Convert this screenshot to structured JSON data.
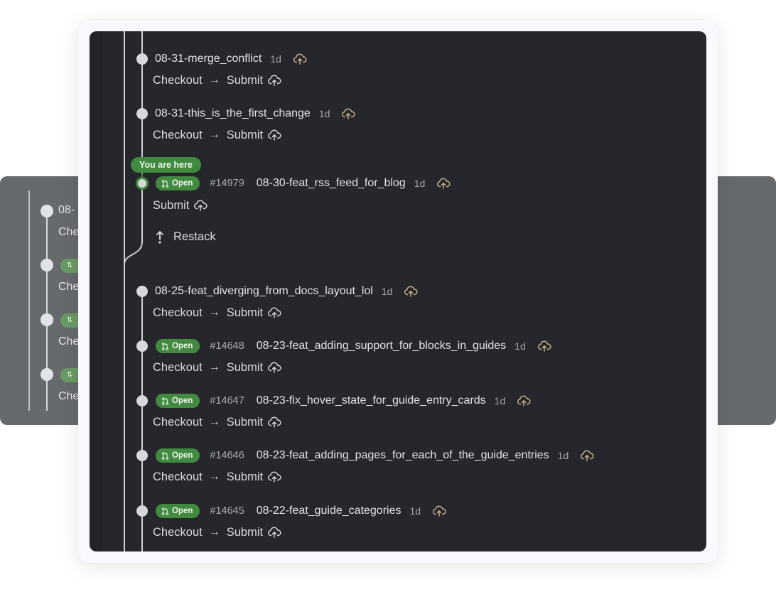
{
  "colors": {
    "panel_bg": "#25272c",
    "badge_green": "#418a3f",
    "cloud_tan": "#c8b185",
    "node": "#d6d8db"
  },
  "current_label": "You are here",
  "badge_icon": "git-pull-request-icon",
  "action_labels": {
    "checkout": "Checkout",
    "arrow": "→",
    "submit": "Submit",
    "restack": "Restack"
  },
  "branches": [
    {
      "name": "08-31-merge_conflict",
      "age": "1d",
      "status": null,
      "pr": null,
      "actions": [
        "Checkout",
        "Submit"
      ]
    },
    {
      "name": "08-31-this_is_the_first_change",
      "age": "1d",
      "status": null,
      "pr": null,
      "actions": [
        "Checkout",
        "Submit"
      ]
    },
    {
      "name": "08-30-feat_rss_feed_for_blog",
      "age": "1d",
      "status": "Open",
      "pr": "#14979",
      "current": true,
      "actions": [
        "Submit"
      ],
      "extra_action": "Restack"
    },
    {
      "name": "08-25-feat_diverging_from_docs_layout_lol",
      "age": "1d",
      "status": null,
      "pr": null,
      "actions": [
        "Checkout",
        "Submit"
      ]
    },
    {
      "name": "08-23-feat_adding_support_for_blocks_in_guides",
      "age": "1d",
      "status": "Open",
      "pr": "#14648",
      "actions": [
        "Checkout",
        "Submit"
      ]
    },
    {
      "name": "08-23-fix_hover_state_for_guide_entry_cards",
      "age": "1d",
      "status": "Open",
      "pr": "#14647",
      "actions": [
        "Checkout",
        "Submit"
      ]
    },
    {
      "name": "08-23-feat_adding_pages_for_each_of_the_guide_entries",
      "age": "1d",
      "status": "Open",
      "pr": "#14646",
      "actions": [
        "Checkout",
        "Submit"
      ]
    },
    {
      "name": "08-22-feat_guide_categories",
      "age": "1d",
      "status": "Open",
      "pr": "#14645",
      "actions": [
        "Checkout",
        "Submit"
      ]
    }
  ],
  "background_stack": {
    "rows": [
      {
        "text": "08-",
        "sub": "Che"
      },
      {
        "badge": true,
        "sub": "Che"
      },
      {
        "badge": true,
        "sub": "Che"
      },
      {
        "badge": true,
        "sub": "Che"
      }
    ]
  }
}
